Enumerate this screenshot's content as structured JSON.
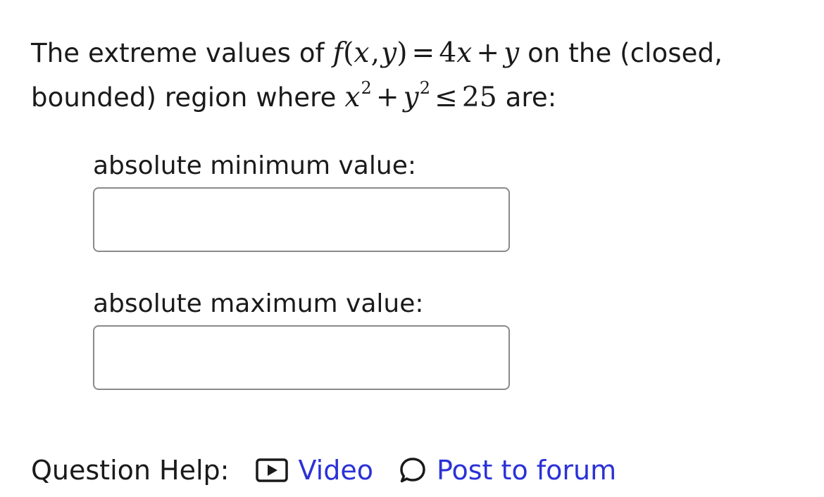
{
  "question": {
    "intro": "The extreme values of",
    "function_f": "f",
    "function_open": "(",
    "function_x": "x",
    "function_comma": ",",
    "function_y": "y",
    "function_close": ")",
    "equals": "=",
    "coefficient": "4",
    "term_x": "x",
    "plus_1": "+",
    "term_y": "y",
    "middle": "on the (closed, bounded) region where",
    "region_x": "x",
    "region_x_exp": "2",
    "plus_2": "+",
    "region_y": "y",
    "region_y_exp": "2",
    "leq": "≤",
    "bound": "25",
    "outro": "are:"
  },
  "fields": {
    "min_label": "absolute minimum value:",
    "min_value": "",
    "max_label": "absolute maximum value:",
    "max_value": ""
  },
  "help": {
    "label": "Question Help:",
    "video_label": "Video",
    "video_icon": "video-play-icon",
    "forum_label": "Post to forum",
    "forum_icon": "speech-bubble-icon",
    "link_color": "#2b32d6"
  }
}
